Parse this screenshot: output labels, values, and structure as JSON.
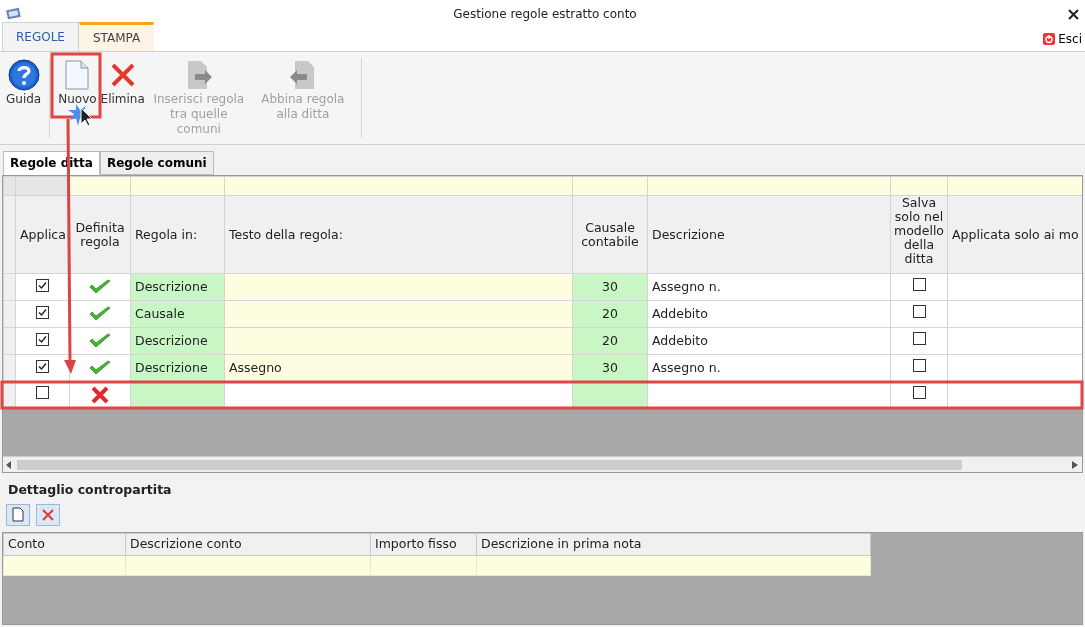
{
  "window": {
    "title": "Gestione regole estratto conto"
  },
  "ribbon_tabs": [
    {
      "label": "REGOLE",
      "selected": true
    },
    {
      "label": "STAMPA",
      "selected": false
    }
  ],
  "exit_button": {
    "label": "Esci"
  },
  "toolbar": [
    {
      "kind": "help",
      "label": "Guida",
      "disabled": false
    },
    {
      "kind": "new",
      "label": "Nuovo",
      "disabled": false
    },
    {
      "kind": "delete",
      "label": "Elimina",
      "disabled": false
    },
    {
      "kind": "insert",
      "label": "Inserisci regola tra quelle comuni",
      "disabled": true
    },
    {
      "kind": "match",
      "label": "Abbina regola alla ditta",
      "disabled": true
    }
  ],
  "grid_tabs": [
    {
      "label": "Regole ditta",
      "selected": true
    },
    {
      "label": "Regole comuni",
      "selected": false
    }
  ],
  "table": {
    "columns": [
      "Applica",
      "Definita regola",
      "Regola in:",
      "Testo della regola:",
      "Causale contabile",
      "Descrizione",
      "Salva solo nel modello della ditta",
      "Applicata solo ai mo"
    ],
    "rows": [
      {
        "applica": true,
        "defined": true,
        "regola_in": "Descrizione",
        "testo": "",
        "causale": "30",
        "descrizione": "Assegno n.",
        "salva": false,
        "selected": false
      },
      {
        "applica": true,
        "defined": true,
        "regola_in": "Causale",
        "testo": "",
        "causale": "20",
        "descrizione": "Addebito",
        "salva": false,
        "selected": false
      },
      {
        "applica": true,
        "defined": true,
        "regola_in": "Descrizione",
        "testo": "",
        "causale": "20",
        "descrizione": "Addebito",
        "salva": false,
        "selected": false
      },
      {
        "applica": true,
        "defined": true,
        "regola_in": "Descrizione",
        "testo": "Assegno",
        "causale": "30",
        "descrizione": "Assegno n.",
        "salva": false,
        "selected": false
      },
      {
        "applica": false,
        "defined": false,
        "regola_in": "",
        "testo": "",
        "causale": "",
        "descrizione": "",
        "salva": false,
        "selected": true
      }
    ]
  },
  "detail": {
    "title": "Dettaglio contropartita",
    "buttons": [
      {
        "kind": "new"
      },
      {
        "kind": "delete"
      }
    ],
    "columns": [
      "Conto",
      "Descrizione conto",
      "Importo fisso",
      "Descrizione in prima nota"
    ]
  }
}
